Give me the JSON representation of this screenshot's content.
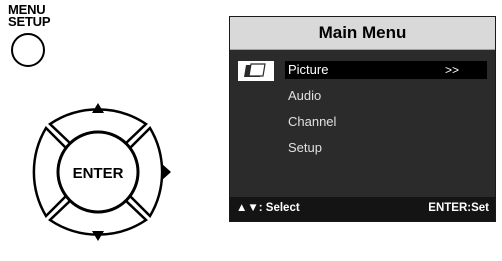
{
  "remote": {
    "menu_label_line1": "MENU",
    "menu_label_line2": "SETUP",
    "enter_label": "ENTER",
    "up_glyph": "▲",
    "down_glyph": "▼",
    "right_glyph": "▶"
  },
  "osd": {
    "title": "Main Menu",
    "items": [
      {
        "label": "Picture",
        "arrow": ">>",
        "selected": true
      },
      {
        "label": "Audio"
      },
      {
        "label": "Channel"
      },
      {
        "label": "Setup"
      }
    ],
    "footer_left": "▲▼: Select",
    "footer_right": "ENTER:Set"
  },
  "colors": {
    "screen_bg": "#2b2b2b",
    "titlebar_bg": "#d9d9d9",
    "footer_bg": "#141414",
    "selected_bg": "#000000"
  }
}
